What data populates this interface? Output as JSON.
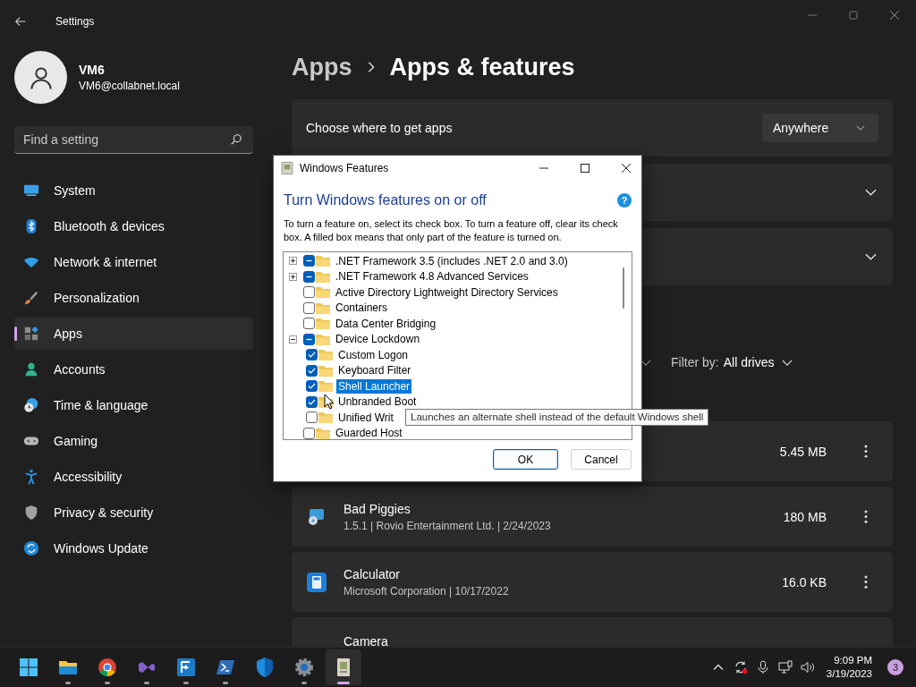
{
  "window": {
    "title": "Settings"
  },
  "account": {
    "name": "VM6",
    "email": "VM6@collabnet.local"
  },
  "search": {
    "placeholder": "Find a setting"
  },
  "nav": [
    {
      "label": "System",
      "selected": false
    },
    {
      "label": "Bluetooth & devices",
      "selected": false
    },
    {
      "label": "Network & internet",
      "selected": false
    },
    {
      "label": "Personalization",
      "selected": false
    },
    {
      "label": "Apps",
      "selected": true
    },
    {
      "label": "Accounts",
      "selected": false
    },
    {
      "label": "Time & language",
      "selected": false
    },
    {
      "label": "Gaming",
      "selected": false
    },
    {
      "label": "Accessibility",
      "selected": false
    },
    {
      "label": "Privacy & security",
      "selected": false
    },
    {
      "label": "Windows Update",
      "selected": false
    }
  ],
  "breadcrumb": {
    "parent": "Apps",
    "current": "Apps & features"
  },
  "source_card": {
    "label": "Choose where to get apps",
    "dropdown": "Anywhere"
  },
  "filter": {
    "label": "Filter by:",
    "value": "All drives"
  },
  "apps": [
    {
      "size": "5.45 MB"
    },
    {
      "name": "Bad Piggies",
      "details": "1.5.1 | Rovio Entertainment Ltd. | 2/24/2023",
      "size": "180 MB"
    },
    {
      "name": "Calculator",
      "details": "Microsoft Corporation | 10/17/2022",
      "size": "16.0 KB"
    },
    {
      "name": "Camera"
    }
  ],
  "dialog": {
    "title": "Windows Features",
    "heading": "Turn Windows features on or off",
    "help": "?",
    "description": "To turn a feature on, select its check box. To turn a feature off, clear its check box. A filled box means that only part of the feature is turned on.",
    "tree": [
      {
        "label": ".NET Framework 3.5 (includes .NET 2.0 and 3.0)",
        "checked": false,
        "partial": true,
        "expanded": false,
        "selected": false
      },
      {
        "label": ".NET Framework 4.8 Advanced Services",
        "checked": false,
        "partial": true,
        "expanded": false,
        "selected": false
      },
      {
        "label": "Active Directory Lightweight Directory Services",
        "checked": false,
        "partial": false,
        "selected": false
      },
      {
        "label": "Containers",
        "checked": false,
        "partial": false,
        "selected": false
      },
      {
        "label": "Data Center Bridging",
        "checked": false,
        "partial": false,
        "selected": false
      },
      {
        "label": "Device Lockdown",
        "checked": false,
        "partial": true,
        "expanded": true,
        "selected": false,
        "children": [
          {
            "label": "Custom Logon",
            "checked": true,
            "selected": false
          },
          {
            "label": "Keyboard Filter",
            "checked": true,
            "selected": false
          },
          {
            "label": "Shell Launcher",
            "checked": true,
            "selected": true
          },
          {
            "label": "Unbranded Boot",
            "checked": true,
            "selected": false
          },
          {
            "label": "Unified Writ",
            "checked": false,
            "partial": false,
            "selected": false
          }
        ]
      },
      {
        "label": "Guarded Host",
        "checked": false,
        "partial": false,
        "selected": false
      }
    ],
    "buttons": [
      {
        "label": "OK",
        "focused": true
      },
      {
        "label": "Cancel",
        "focused": false
      }
    ]
  },
  "tooltip": {
    "text": "Launches an alternate shell instead of the default Windows shell"
  },
  "taskbar": {
    "apps": [
      {
        "running": false,
        "active": false
      },
      {
        "running": true,
        "active": false
      },
      {
        "running": true,
        "active": false
      },
      {
        "running": true,
        "active": false
      },
      {
        "running": true,
        "active": false
      },
      {
        "running": true,
        "active": false
      },
      {
        "running": false,
        "active": false
      },
      {
        "running": true,
        "active": false
      },
      {
        "running": true,
        "active": true
      }
    ],
    "time": "9:09 PM",
    "date": "3/19/2023",
    "notifications": "3"
  }
}
